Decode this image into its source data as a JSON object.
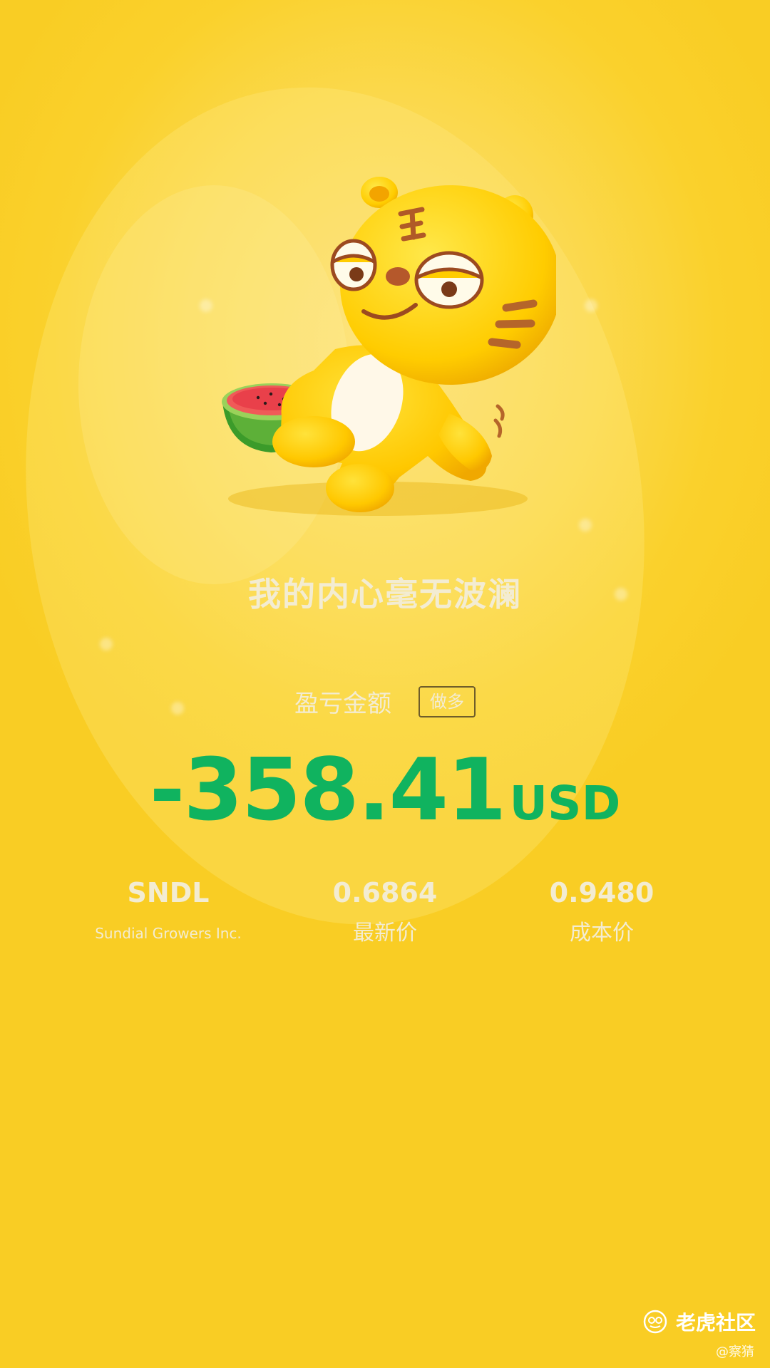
{
  "slogan": "我的内心毫无波澜",
  "pnl": {
    "label": "盈亏金额",
    "direction": "做多",
    "amount": "-358.41",
    "currency": "USD",
    "amount_color": "#10b35f"
  },
  "stock": {
    "ticker": "SNDL",
    "company": "Sundial Growers Inc.",
    "latest_price": "0.6864",
    "latest_price_label": "最新价",
    "cost_price": "0.9480",
    "cost_price_label": "成本价"
  },
  "brand": {
    "name": "老虎社区",
    "icon": "tiger-logo-icon"
  },
  "watermark": "@察猜",
  "mascot": "tiger-mascot-with-watermelon"
}
